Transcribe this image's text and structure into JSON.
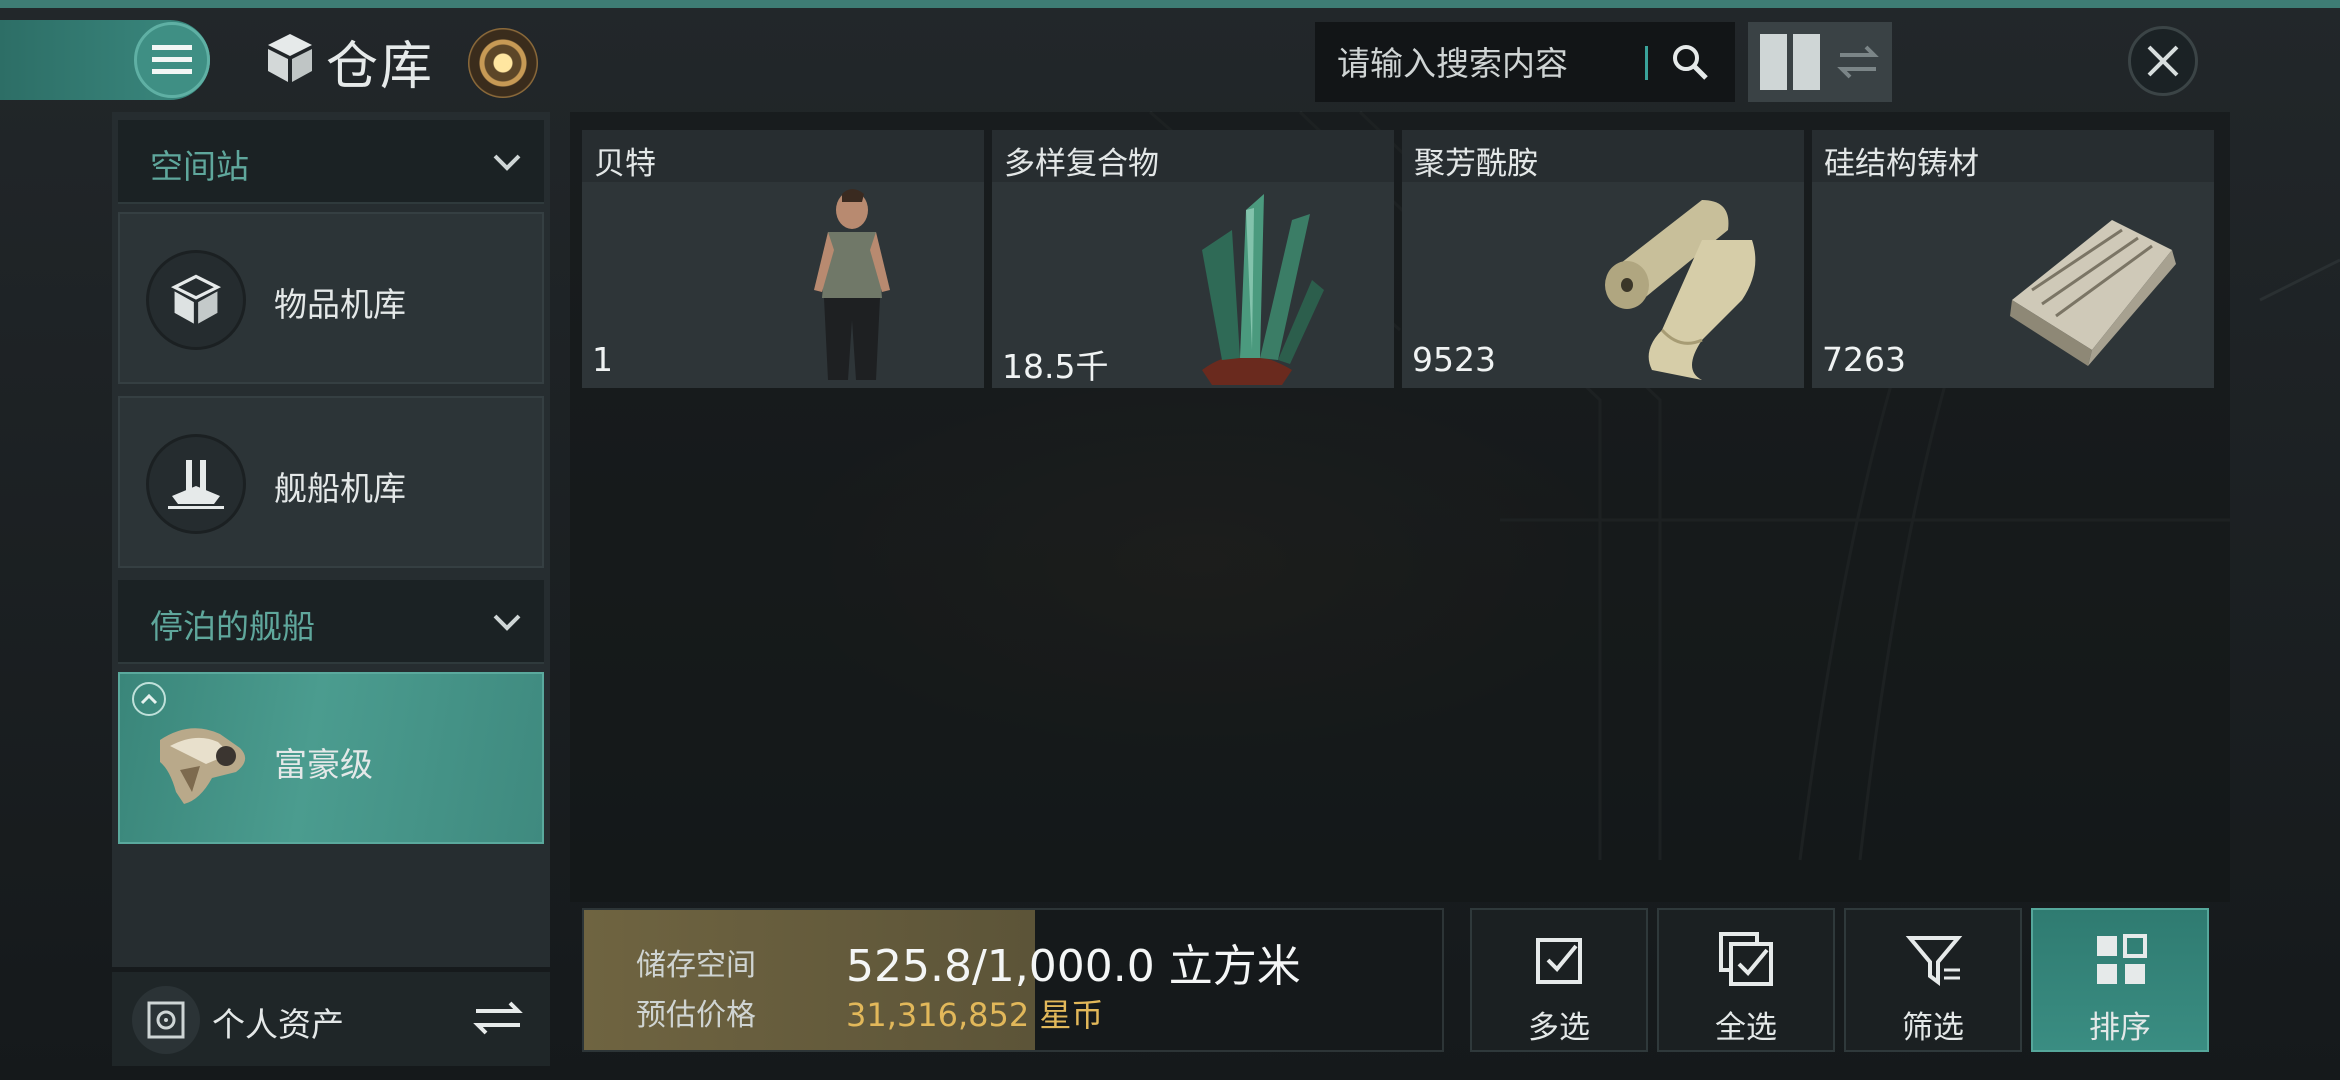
{
  "header": {
    "title": "仓库",
    "search_placeholder": "请输入搜索内容"
  },
  "sidebar": {
    "sections": [
      {
        "label": "空间站"
      },
      {
        "label": "停泊的舰船"
      }
    ],
    "items": [
      {
        "label": "物品机库",
        "icon": "cube-icon"
      },
      {
        "label": "舰船机库",
        "icon": "ship-hangar-icon"
      },
      {
        "label": "富豪级",
        "icon": "ship-icon",
        "active": true
      }
    ],
    "assets_label": "个人资产"
  },
  "items": [
    {
      "name": "贝特",
      "quantity": "1"
    },
    {
      "name": "多样复合物",
      "quantity": "18.5千"
    },
    {
      "name": "聚芳酰胺",
      "quantity": "9523"
    },
    {
      "name": "硅结构铸材",
      "quantity": "7263"
    }
  ],
  "storage": {
    "label": "储存空间",
    "value": "525.8/1,000.0 立方米",
    "fill_fraction": 0.5258,
    "price_label": "预估价格",
    "price_value": "31,316,852 星币"
  },
  "actions": [
    {
      "label": "多选"
    },
    {
      "label": "全选"
    },
    {
      "label": "筛选"
    },
    {
      "label": "排序"
    }
  ],
  "colors": {
    "accent": "#3d8a80",
    "price": "#e2b85a",
    "storage_fill": "#6f6441"
  }
}
